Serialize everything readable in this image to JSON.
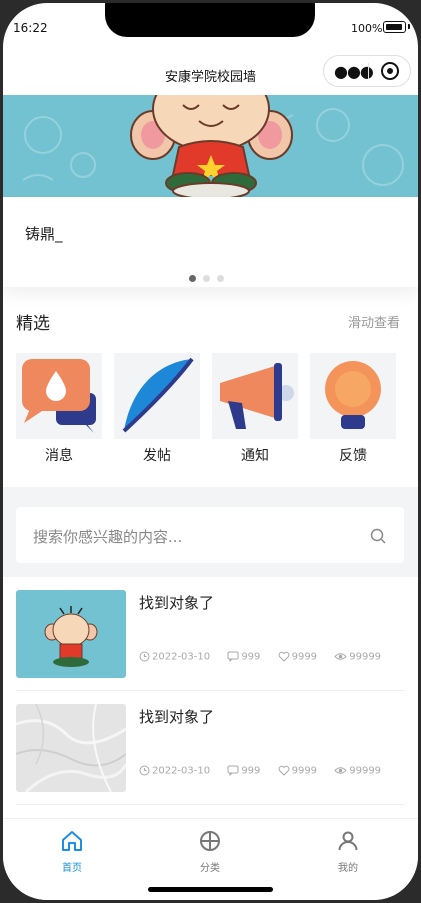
{
  "status": {
    "time": "16:22",
    "battery": "100%"
  },
  "navbar": {
    "title": "安康学院校园墙"
  },
  "banner": {
    "caption": "铸鼎_",
    "pages": 3,
    "active_page": 1
  },
  "featured": {
    "title": "精选",
    "more": "滑动查看",
    "items": [
      {
        "label": "消息",
        "icon": "message-bubble-icon"
      },
      {
        "label": "发帖",
        "icon": "feather-quill-icon"
      },
      {
        "label": "通知",
        "icon": "megaphone-icon"
      },
      {
        "label": "反馈",
        "icon": "lightbulb-icon"
      }
    ]
  },
  "search": {
    "placeholder": "搜索你感兴趣的内容..."
  },
  "posts": [
    {
      "title": "找到对象了",
      "date": "2022-03-10",
      "comments": "999",
      "likes": "9999",
      "views": "99999"
    },
    {
      "title": "找到对象了",
      "date": "2022-03-10",
      "comments": "999",
      "likes": "9999",
      "views": "99999"
    }
  ],
  "tabbar": {
    "accent": "#1d8fe0",
    "inactive": "#777777",
    "items": [
      {
        "label": "首页",
        "icon": "home-icon",
        "active": true
      },
      {
        "label": "分类",
        "icon": "category-icon",
        "active": false
      },
      {
        "label": "我的",
        "icon": "user-icon",
        "active": false
      }
    ]
  }
}
